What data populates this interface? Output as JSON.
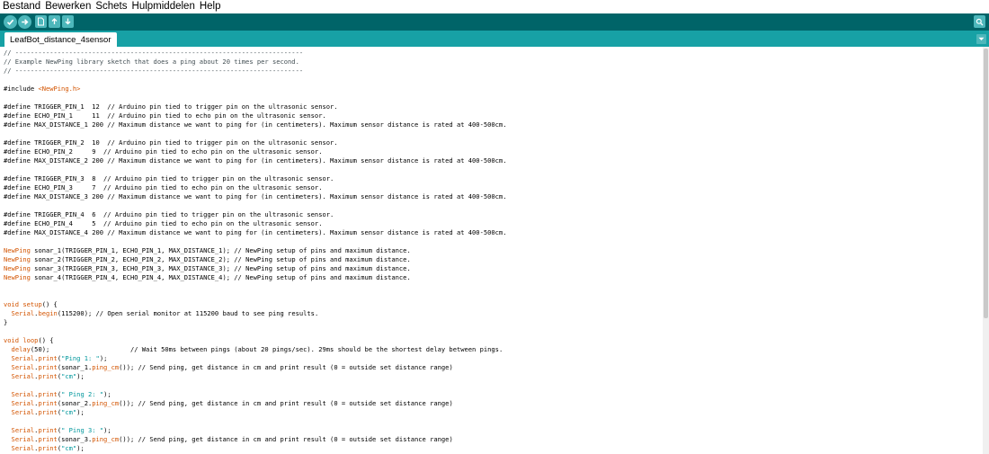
{
  "menubar": {
    "items": [
      "Bestand",
      "Bewerken",
      "Schets",
      "Hulpmiddelen",
      "Help"
    ]
  },
  "toolbar": {
    "buttons": [
      "verify-icon",
      "upload-icon",
      "new-icon",
      "open-icon",
      "save-icon"
    ],
    "right_button": "serial-monitor-icon"
  },
  "tabs": {
    "active": "LeafBot_distance_4sensor"
  },
  "colors": {
    "toolbar_bg": "#006468",
    "tabbar_bg": "#17a1a5",
    "button_bg": "#4db7bb",
    "keyword": "#d35400",
    "function": "#00979c"
  },
  "editor": {
    "lines": [
      [
        {
          "t": "// ---------------------------------------------------------------------------",
          "c": "cm"
        }
      ],
      [
        {
          "t": "// Example NewPing library sketch that does a ping about 20 times per second.",
          "c": "cm"
        }
      ],
      [
        {
          "t": "// ---------------------------------------------------------------------------",
          "c": "cm"
        }
      ],
      [],
      [
        {
          "t": "#include "
        },
        {
          "t": "<NewPing.h>",
          "c": "inc"
        }
      ],
      [],
      [
        {
          "t": "#define TRIGGER_PIN_1  12  // Arduino pin tied to trigger pin on the ultrasonic sensor."
        }
      ],
      [
        {
          "t": "#define ECHO_PIN_1     11  // Arduino pin tied to echo pin on the ultrasonic sensor."
        }
      ],
      [
        {
          "t": "#define MAX_DISTANCE_1 200 // Maximum distance we want to ping for (in centimeters). Maximum sensor distance is rated at 400-500cm."
        }
      ],
      [],
      [
        {
          "t": "#define TRIGGER_PIN_2  10  // Arduino pin tied to trigger pin on the ultrasonic sensor."
        }
      ],
      [
        {
          "t": "#define ECHO_PIN_2     9  // Arduino pin tied to echo pin on the ultrasonic sensor."
        }
      ],
      [
        {
          "t": "#define MAX_DISTANCE_2 200 // Maximum distance we want to ping for (in centimeters). Maximum sensor distance is rated at 400-500cm."
        }
      ],
      [],
      [
        {
          "t": "#define TRIGGER_PIN_3  8  // Arduino pin tied to trigger pin on the ultrasonic sensor."
        }
      ],
      [
        {
          "t": "#define ECHO_PIN_3     7  // Arduino pin tied to echo pin on the ultrasonic sensor."
        }
      ],
      [
        {
          "t": "#define MAX_DISTANCE_3 200 // Maximum distance we want to ping for (in centimeters). Maximum sensor distance is rated at 400-500cm."
        }
      ],
      [],
      [
        {
          "t": "#define TRIGGER_PIN_4  6  // Arduino pin tied to trigger pin on the ultrasonic sensor."
        }
      ],
      [
        {
          "t": "#define ECHO_PIN_4     5  // Arduino pin tied to echo pin on the ultrasonic sensor."
        }
      ],
      [
        {
          "t": "#define MAX_DISTANCE_4 200 // Maximum distance we want to ping for (in centimeters). Maximum sensor distance is rated at 400-500cm."
        }
      ],
      [],
      [
        {
          "t": "NewPing",
          "c": "kw"
        },
        {
          "t": " sonar_1(TRIGGER_PIN_1, ECHO_PIN_1, MAX_DISTANCE_1); // NewPing setup of pins and maximum distance."
        }
      ],
      [
        {
          "t": "NewPing",
          "c": "kw"
        },
        {
          "t": " sonar_2(TRIGGER_PIN_2, ECHO_PIN_2, MAX_DISTANCE_2); // NewPing setup of pins and maximum distance."
        }
      ],
      [
        {
          "t": "NewPing",
          "c": "kw"
        },
        {
          "t": " sonar_3(TRIGGER_PIN_3, ECHO_PIN_3, MAX_DISTANCE_3); // NewPing setup of pins and maximum distance."
        }
      ],
      [
        {
          "t": "NewPing",
          "c": "kw"
        },
        {
          "t": " sonar_4(TRIGGER_PIN_4, ECHO_PIN_4, MAX_DISTANCE_4); // NewPing setup of pins and maximum distance."
        }
      ],
      [],
      [],
      [
        {
          "t": "void",
          "c": "kw"
        },
        {
          "t": " "
        },
        {
          "t": "setup",
          "c": "kw"
        },
        {
          "t": "() {"
        }
      ],
      [
        {
          "t": "  "
        },
        {
          "t": "Serial",
          "c": "kw"
        },
        {
          "t": "."
        },
        {
          "t": "begin",
          "c": "kw"
        },
        {
          "t": "(115200); // Open serial monitor at 115200 baud to see ping results."
        }
      ],
      [
        {
          "t": "}"
        }
      ],
      [],
      [
        {
          "t": "void",
          "c": "kw"
        },
        {
          "t": " "
        },
        {
          "t": "loop",
          "c": "kw"
        },
        {
          "t": "() {"
        }
      ],
      [
        {
          "t": "  "
        },
        {
          "t": "delay",
          "c": "kw"
        },
        {
          "t": "(50);                     // Wait 50ms between pings (about 20 pings/sec). 29ms should be the shortest delay between pings."
        }
      ],
      [
        {
          "t": "  "
        },
        {
          "t": "Serial",
          "c": "kw"
        },
        {
          "t": "."
        },
        {
          "t": "print",
          "c": "kw"
        },
        {
          "t": "("
        },
        {
          "t": "\"Ping 1: \"",
          "c": "fn"
        },
        {
          "t": ");"
        }
      ],
      [
        {
          "t": "  "
        },
        {
          "t": "Serial",
          "c": "kw"
        },
        {
          "t": "."
        },
        {
          "t": "print",
          "c": "kw"
        },
        {
          "t": "(sonar_1."
        },
        {
          "t": "ping_cm",
          "c": "kw"
        },
        {
          "t": "()); // Send ping, get distance in cm and print result (0 = outside set distance range)"
        }
      ],
      [
        {
          "t": "  "
        },
        {
          "t": "Serial",
          "c": "kw"
        },
        {
          "t": "."
        },
        {
          "t": "print",
          "c": "kw"
        },
        {
          "t": "("
        },
        {
          "t": "\"cm\"",
          "c": "fn"
        },
        {
          "t": ");"
        }
      ],
      [],
      [
        {
          "t": "  "
        },
        {
          "t": "Serial",
          "c": "kw"
        },
        {
          "t": "."
        },
        {
          "t": "print",
          "c": "kw"
        },
        {
          "t": "("
        },
        {
          "t": "\" Ping 2: \"",
          "c": "fn"
        },
        {
          "t": ");"
        }
      ],
      [
        {
          "t": "  "
        },
        {
          "t": "Serial",
          "c": "kw"
        },
        {
          "t": "."
        },
        {
          "t": "print",
          "c": "kw"
        },
        {
          "t": "(sonar_2."
        },
        {
          "t": "ping_cm",
          "c": "kw"
        },
        {
          "t": "()); // Send ping, get distance in cm and print result (0 = outside set distance range)"
        }
      ],
      [
        {
          "t": "  "
        },
        {
          "t": "Serial",
          "c": "kw"
        },
        {
          "t": "."
        },
        {
          "t": "print",
          "c": "kw"
        },
        {
          "t": "("
        },
        {
          "t": "\"cm\"",
          "c": "fn"
        },
        {
          "t": ");"
        }
      ],
      [],
      [
        {
          "t": "  "
        },
        {
          "t": "Serial",
          "c": "kw"
        },
        {
          "t": "."
        },
        {
          "t": "print",
          "c": "kw"
        },
        {
          "t": "("
        },
        {
          "t": "\" Ping 3: \"",
          "c": "fn"
        },
        {
          "t": ");"
        }
      ],
      [
        {
          "t": "  "
        },
        {
          "t": "Serial",
          "c": "kw"
        },
        {
          "t": "."
        },
        {
          "t": "print",
          "c": "kw"
        },
        {
          "t": "(sonar_3."
        },
        {
          "t": "ping_cm",
          "c": "kw"
        },
        {
          "t": "()); // Send ping, get distance in cm and print result (0 = outside set distance range)"
        }
      ],
      [
        {
          "t": "  "
        },
        {
          "t": "Serial",
          "c": "kw"
        },
        {
          "t": "."
        },
        {
          "t": "print",
          "c": "kw"
        },
        {
          "t": "("
        },
        {
          "t": "\"cm\"",
          "c": "fn"
        },
        {
          "t": ");"
        }
      ]
    ]
  }
}
